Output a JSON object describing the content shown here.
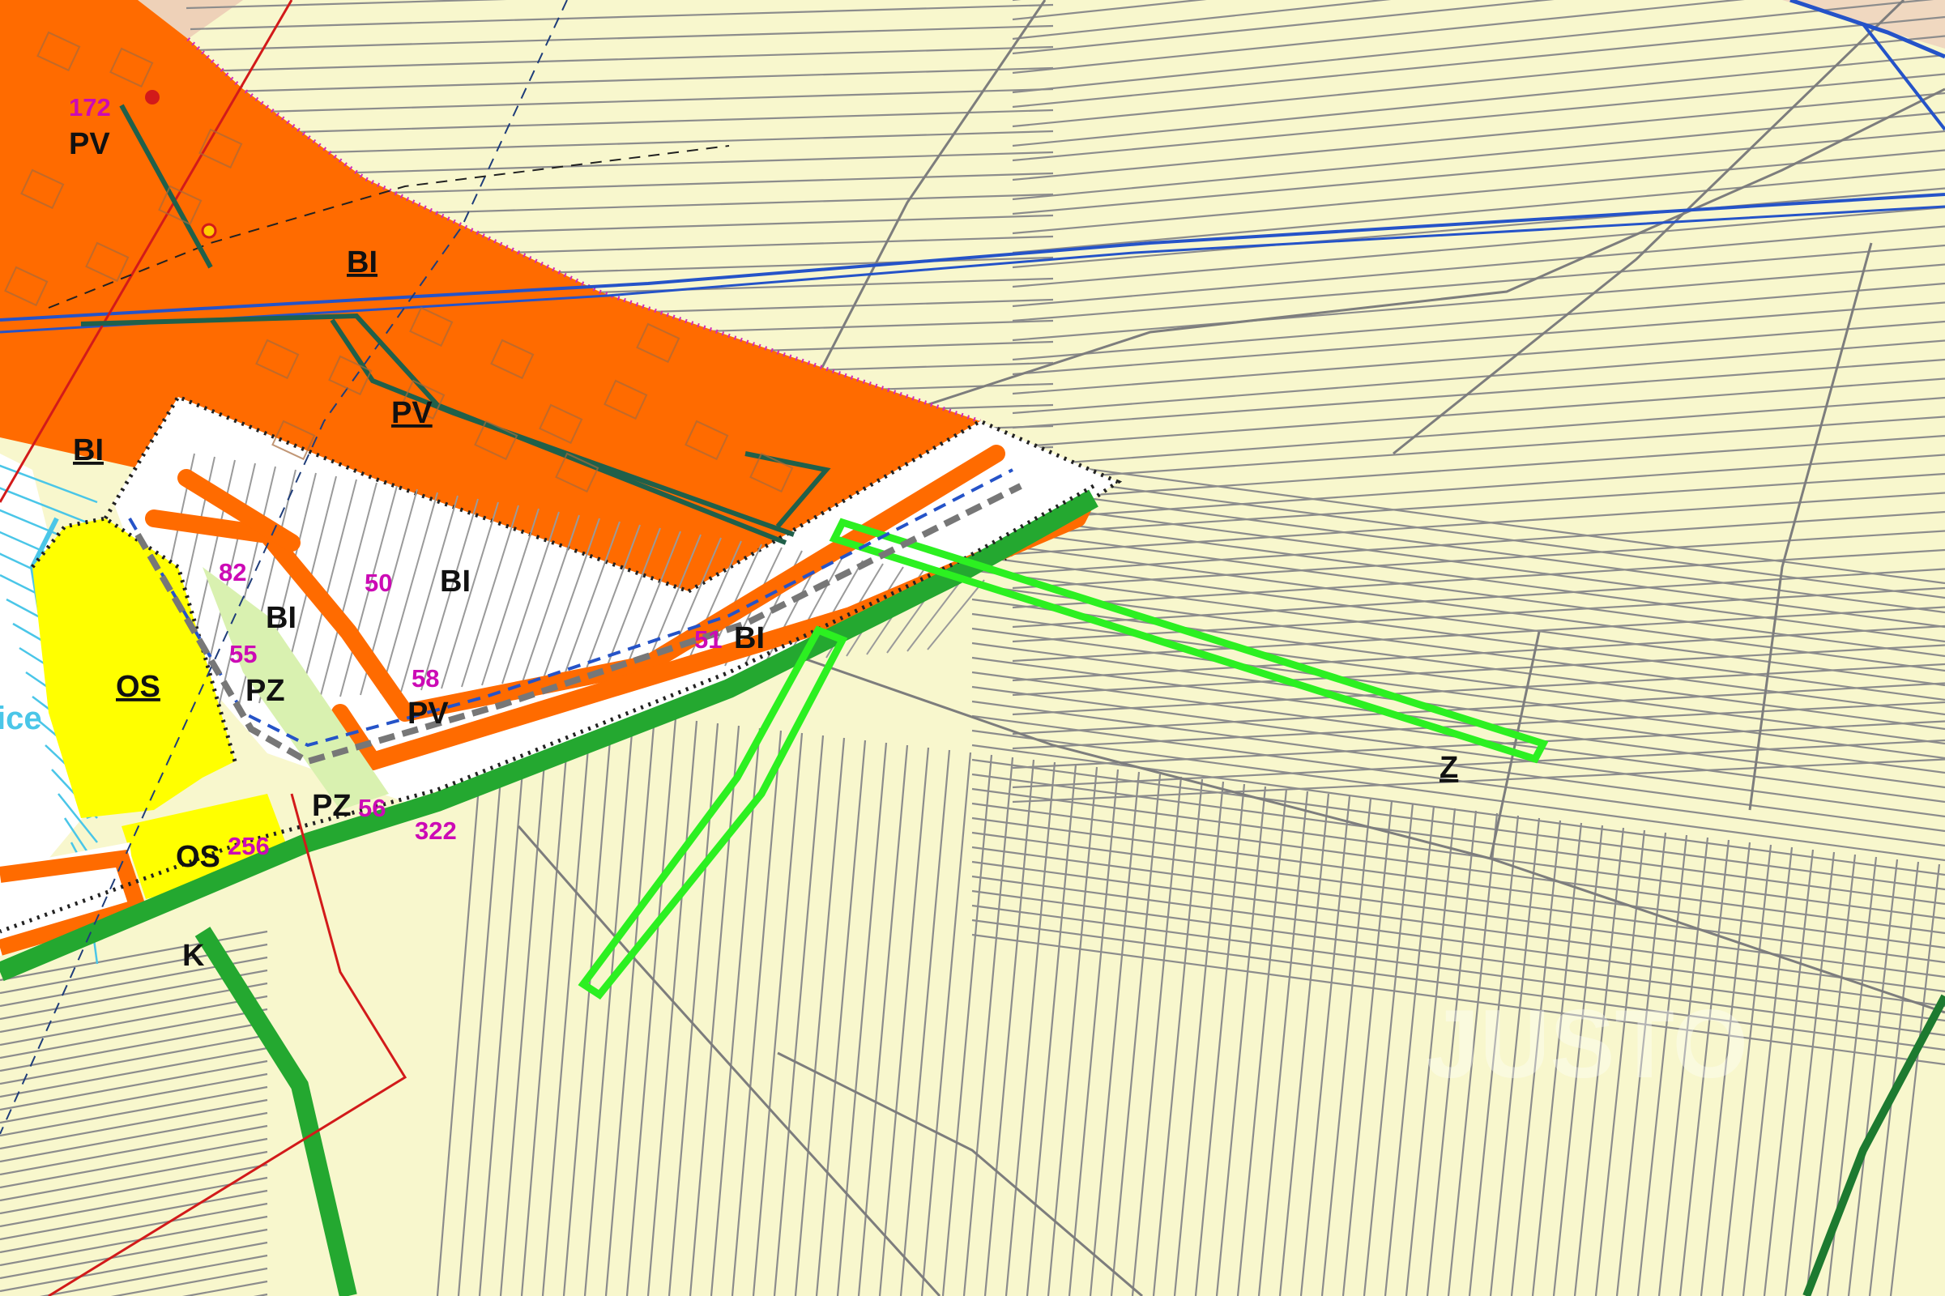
{
  "colors": {
    "background": "#f8f7cd",
    "residential": "#ff6b00",
    "sport_area": "#ffff00",
    "parcel_line": "#8c8c8c",
    "greenway": "#24a830",
    "proposed_green": "#2cf021",
    "utility_blue": "#2553c8",
    "power_red": "#d21a1a",
    "zone_magenta": "#d12bb7",
    "label_number": "#cc0ab5",
    "water": "#4ac6e8"
  },
  "zone_labels": [
    {
      "id": "pv-top",
      "text": "PV"
    },
    {
      "id": "bi-top",
      "text": "BI"
    },
    {
      "id": "pv-mid",
      "text": "PV"
    },
    {
      "id": "bi-left",
      "text": "BI"
    },
    {
      "id": "bi-center",
      "text": "BI"
    },
    {
      "id": "bi-inner",
      "text": "BI"
    },
    {
      "id": "bi-right",
      "text": "BI"
    },
    {
      "id": "os-upper",
      "text": "OS"
    },
    {
      "id": "pz-upper",
      "text": "PZ"
    },
    {
      "id": "pv-lower",
      "text": "PV"
    },
    {
      "id": "pz-lower",
      "text": "PZ"
    },
    {
      "id": "os-lower",
      "text": "OS"
    },
    {
      "id": "k-corridor",
      "text": "K"
    },
    {
      "id": "z-green",
      "text": "Z"
    }
  ],
  "area_numbers": [
    {
      "id": "n172",
      "text": "172"
    },
    {
      "id": "n82",
      "text": "82"
    },
    {
      "id": "n50",
      "text": "50"
    },
    {
      "id": "n55",
      "text": "55"
    },
    {
      "id": "n58",
      "text": "58"
    },
    {
      "id": "n51",
      "text": "51"
    },
    {
      "id": "n56",
      "text": "56"
    },
    {
      "id": "n322",
      "text": "322"
    },
    {
      "id": "n256",
      "text": "256"
    }
  ],
  "place_name_fragment": "ice",
  "watermark": "JUSTO"
}
